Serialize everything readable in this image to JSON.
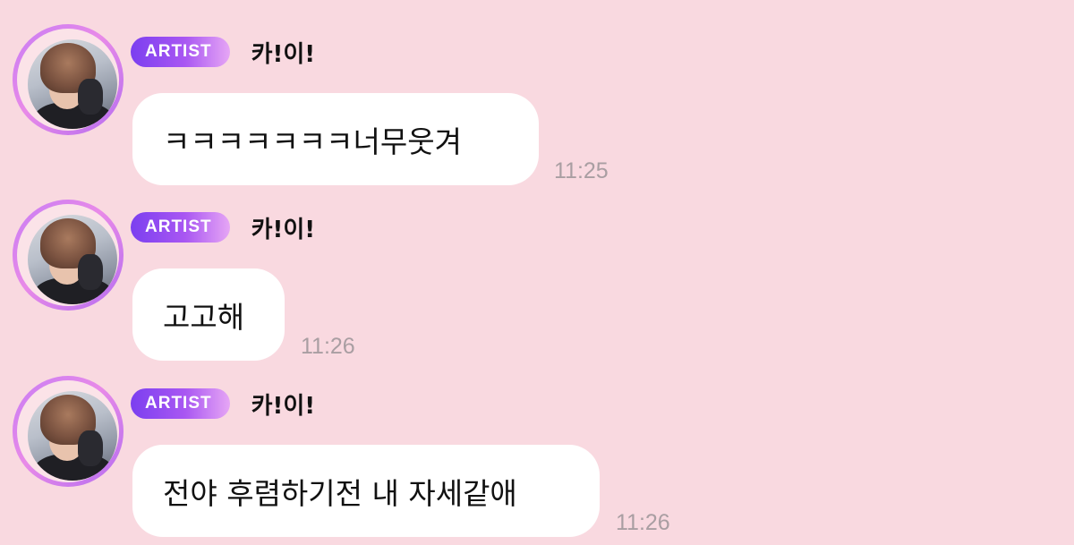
{
  "messages": [
    {
      "badge": "ARTIST",
      "sender": "카!이!",
      "text": "ㅋㅋㅋㅋㅋㅋㅋ너무웃겨",
      "time": "11:25"
    },
    {
      "badge": "ARTIST",
      "sender": "카!이!",
      "text": "고고해",
      "time": "11:26"
    },
    {
      "badge": "ARTIST",
      "sender": "카!이!",
      "text": "전야 후렴하기전 내 자세같애",
      "time": "11:26"
    }
  ]
}
